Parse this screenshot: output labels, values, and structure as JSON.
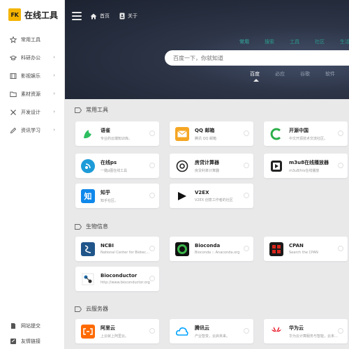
{
  "brand": {
    "badge": "FK",
    "name": "在线工具"
  },
  "sidebar": {
    "items": [
      {
        "label": "常用工具",
        "icon": "star-icon",
        "has_chevron": false
      },
      {
        "label": "科研办公",
        "icon": "graduation-cap-icon",
        "has_chevron": true
      },
      {
        "label": "影视娱乐",
        "icon": "film-icon",
        "has_chevron": true
      },
      {
        "label": "素材资源",
        "icon": "folder-icon",
        "has_chevron": true
      },
      {
        "label": "开发设计",
        "icon": "tools-icon",
        "has_chevron": true
      },
      {
        "label": "资讯学习",
        "icon": "pencil-icon",
        "has_chevron": true
      }
    ],
    "bottom_items": [
      {
        "label": "网站提交",
        "icon": "document-icon"
      },
      {
        "label": "友情链接",
        "icon": "link-icon"
      }
    ]
  },
  "header": {
    "links": [
      {
        "label": "首页",
        "icon": "home-icon"
      },
      {
        "label": "关于",
        "icon": "contact-card-icon"
      }
    ]
  },
  "search": {
    "tabs": [
      "常用",
      "搜索",
      "工具",
      "社区",
      "生活"
    ],
    "active_tab": "常用",
    "placeholder": "百度一下，你就知道",
    "engines": [
      "百度",
      "必应",
      "谷歌",
      "软件"
    ],
    "active_engine": "百度"
  },
  "sections": [
    {
      "title": "常用工具",
      "cards": [
        {
          "name": "语雀",
          "desc": "专业的云端知识库。",
          "logo_bg": "#ffffff",
          "logo_fg": "#2dbe60",
          "logo_char": "▲"
        },
        {
          "name": "QQ 邮箱",
          "desc": "腾讯 QQ 邮箱",
          "logo_bg": "#f5a623",
          "logo_fg": "#ffffff",
          "logo_char": "✉"
        },
        {
          "name": "开源中国",
          "desc": "中文开源技术交流社区。",
          "logo_bg": "#ffffff",
          "logo_fg": "#2cae4a",
          "logo_char": "C"
        },
        {
          "name": "在线ps",
          "desc": "一键p图在线工具",
          "logo_bg": "#1d9bd8",
          "logo_fg": "#ffffff",
          "logo_char": "◔"
        },
        {
          "name": "房贷计算器",
          "desc": "房贷利率计算器",
          "logo_bg": "#ffffff",
          "logo_fg": "#222222",
          "logo_char": "◎"
        },
        {
          "name": "m3u8在线播放器",
          "desc": "m3u8/hls在线播放",
          "logo_bg": "#ffffff",
          "logo_fg": "#222222",
          "logo_char": "▣"
        },
        {
          "name": "知乎",
          "desc": "知乎社区。",
          "logo_bg": "#0f88eb",
          "logo_fg": "#ffffff",
          "logo_char": "知"
        },
        {
          "name": "V2EX",
          "desc": "V2EX 创意工作者的社区",
          "logo_bg": "#ffffff",
          "logo_fg": "#111111",
          "logo_char": "▶"
        }
      ]
    },
    {
      "title": "生物信息",
      "cards": [
        {
          "name": "NCBI",
          "desc": "National Center for Biotechnology Information",
          "logo_bg": "#20558a",
          "logo_fg": "#ffffff",
          "logo_char": "§"
        },
        {
          "name": "Bioconda",
          "desc": "Bioconda :: Anaconda.org",
          "logo_bg": "#111111",
          "logo_fg": "#3bb54a",
          "logo_char": "◉"
        },
        {
          "name": "CPAN",
          "desc": "Search the CPAN",
          "logo_bg": "#1a1a1a",
          "logo_fg": "#d9261c",
          "logo_char": "▦"
        },
        {
          "name": "Bioconductor",
          "desc": "http://www.bioconductor.org",
          "logo_bg": "#ffffff",
          "logo_fg": "#1a6aa8",
          "logo_char": "✚"
        }
      ]
    },
    {
      "title": "云服务器",
      "cards": [
        {
          "name": "阿里云",
          "desc": "上云就上阿里云。",
          "logo_bg": "#ff6a00",
          "logo_fg": "#ffffff",
          "logo_char": "[-]"
        },
        {
          "name": "腾讯云",
          "desc": "产业智变，云启未来。",
          "logo_bg": "#ffffff",
          "logo_fg": "#00a3ff",
          "logo_char": "☁"
        },
        {
          "name": "华为云",
          "desc": "华为云计算服务与智能，云未来。",
          "logo_bg": "#ffffff",
          "logo_fg": "#e60012",
          "logo_char": "✿"
        }
      ]
    }
  ]
}
